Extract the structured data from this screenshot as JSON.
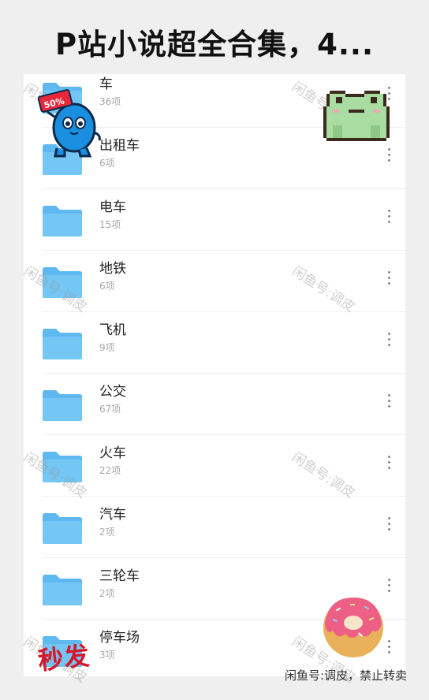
{
  "title": "P站小说超全合集，4...",
  "folders": [
    {
      "name": "车",
      "count": "36项"
    },
    {
      "name": "出租车",
      "count": "6项"
    },
    {
      "name": "电车",
      "count": "15项"
    },
    {
      "name": "地铁",
      "count": "6项"
    },
    {
      "name": "飞机",
      "count": "9项"
    },
    {
      "name": "公交",
      "count": "67项"
    },
    {
      "name": "火车",
      "count": "22项"
    },
    {
      "name": "汽车",
      "count": "2项"
    },
    {
      "name": "三轮车",
      "count": "2项"
    },
    {
      "name": "停车场",
      "count": "3项"
    }
  ],
  "watermark": "闲鱼号:调皮",
  "sticker_badge": "50%",
  "stamp_text": "秒发",
  "footer": "闲鱼号:调皮，禁止转卖",
  "colors": {
    "folder": "#74c6f4",
    "folder_tab": "#5fb8ef",
    "stamp": "#d6182b"
  }
}
